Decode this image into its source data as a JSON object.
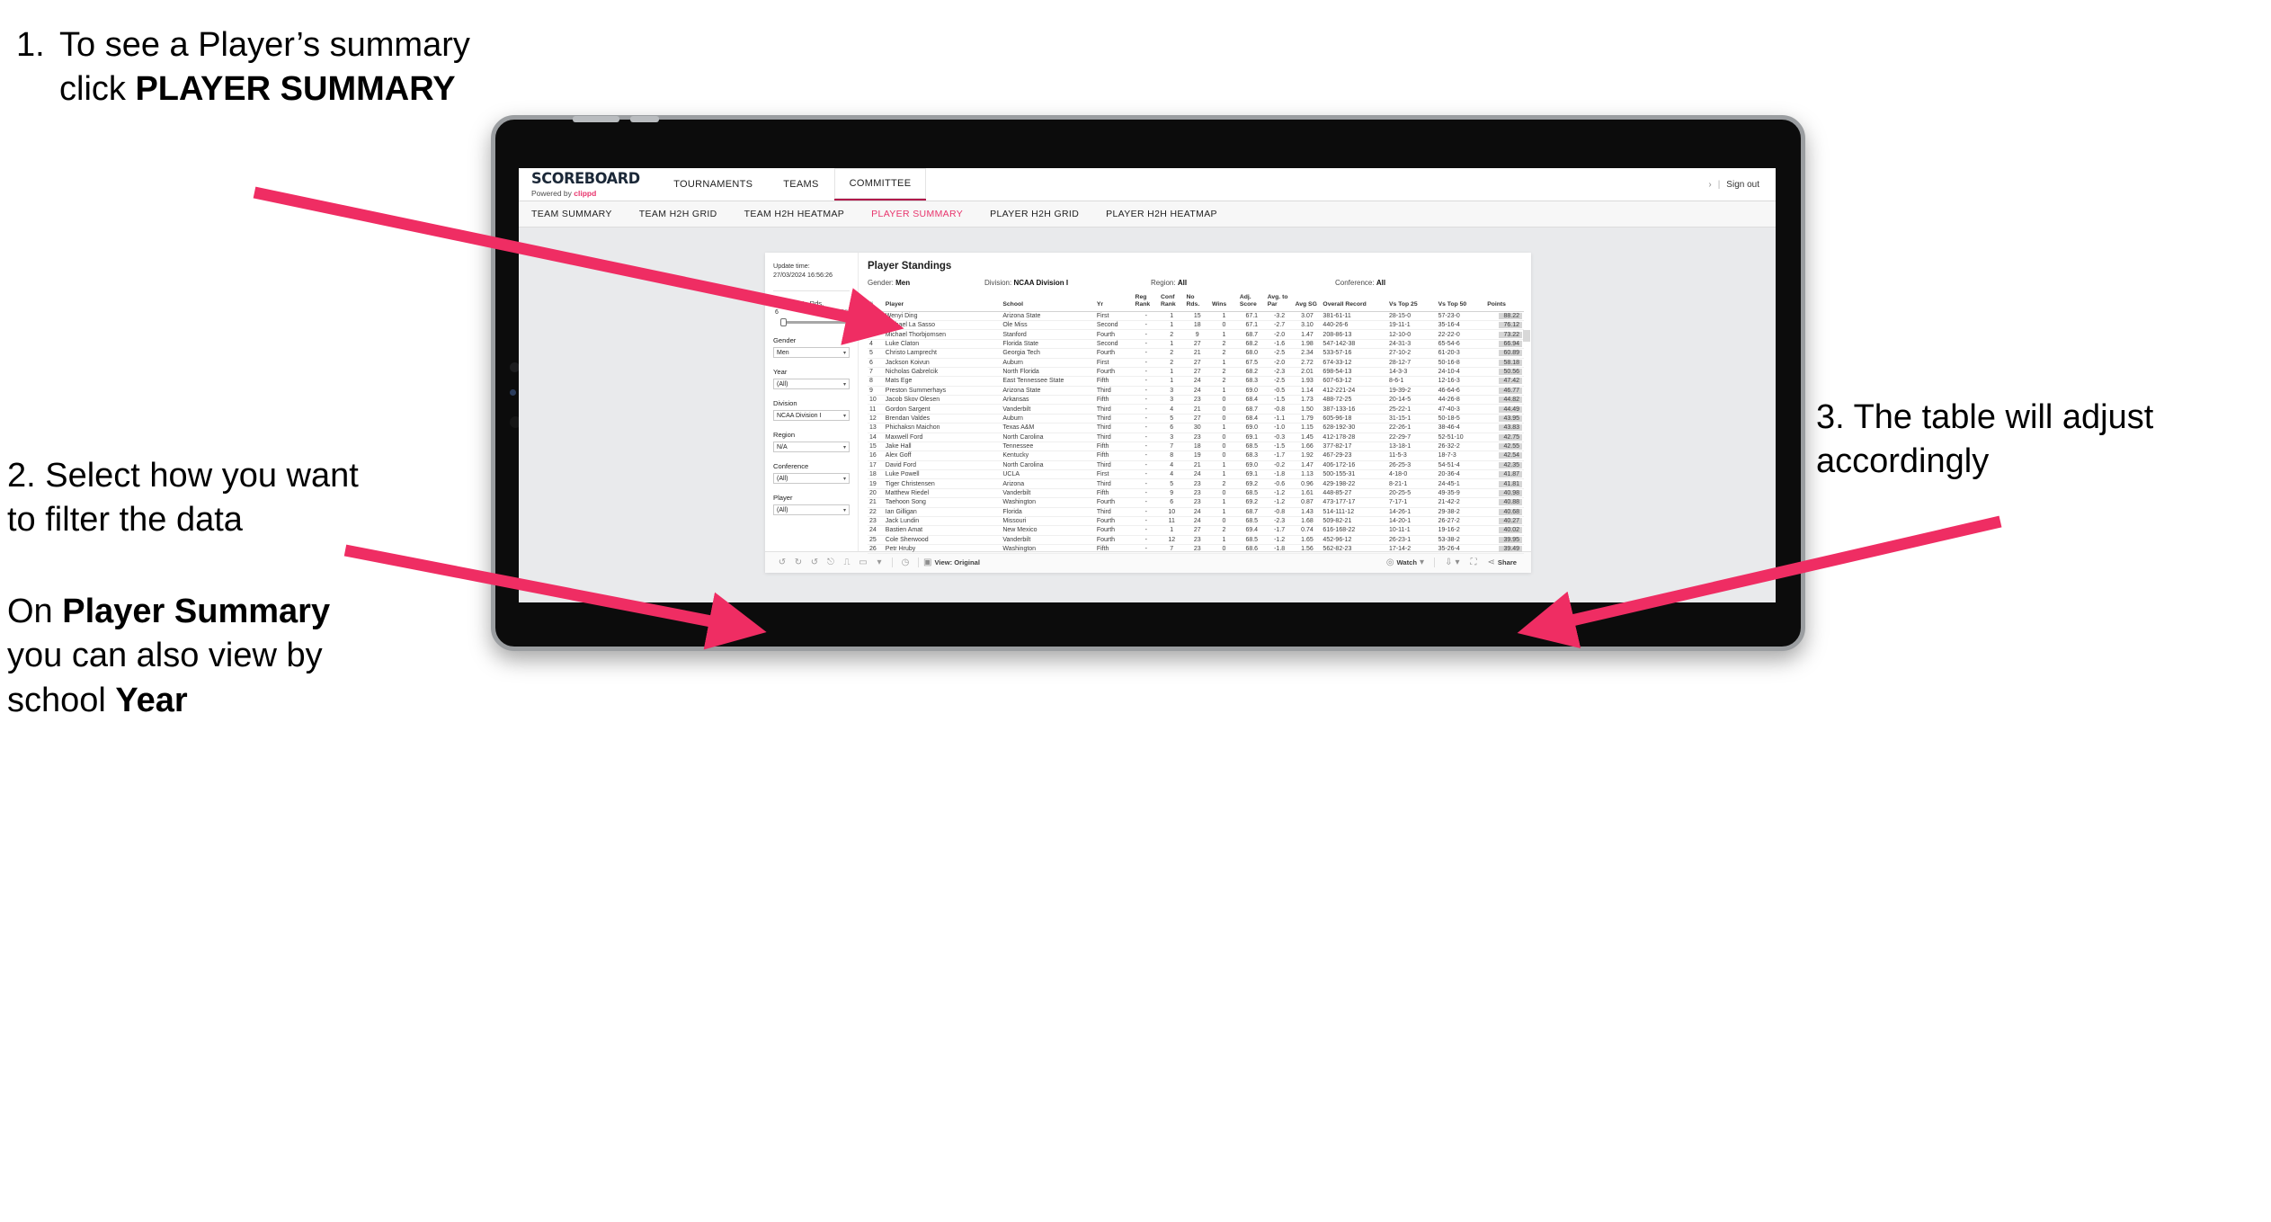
{
  "annotations": {
    "a1": {
      "num": "1.",
      "text_pre": "To see a Player’s summary click ",
      "bold": "PLAYER SUMMARY"
    },
    "a2": {
      "p1": "2. Select how you want to filter the data",
      "p2_pre": "On ",
      "p2_bold1": "Player Summary",
      "p2_mid": " you can also view by school ",
      "p2_bold2": "Year"
    },
    "a3": {
      "text": "3. The table will adjust accordingly"
    },
    "accent_color": "#ef2d63"
  },
  "app": {
    "brand": {
      "title": "SCOREBOARD",
      "sub_pre": "Powered by ",
      "sub_brand": "clippd"
    },
    "top_nav": [
      {
        "label": "TOURNAMENTS",
        "active": false
      },
      {
        "label": "TEAMS",
        "active": false
      },
      {
        "label": "COMMITTEE",
        "active": true
      }
    ],
    "header_right": {
      "chevron": "›",
      "separator": "|",
      "sign_out": "Sign out"
    },
    "sub_nav": [
      {
        "label": "TEAM SUMMARY",
        "active": false
      },
      {
        "label": "TEAM H2H GRID",
        "active": false
      },
      {
        "label": "TEAM H2H HEATMAP",
        "active": false
      },
      {
        "label": "PLAYER SUMMARY",
        "active": true
      },
      {
        "label": "PLAYER H2H GRID",
        "active": false
      },
      {
        "label": "PLAYER H2H HEATMAP",
        "active": false
      }
    ],
    "accent_pink": "#e8356d"
  },
  "filters": {
    "update_label": "Update time:",
    "update_value": "27/03/2024 16:56:26",
    "slider": {
      "title": "No Rds.",
      "min": "6",
      "max": "52"
    },
    "groups": [
      {
        "label": "Gender",
        "value": "Men"
      },
      {
        "label": "Year",
        "value": "(All)"
      },
      {
        "label": "Division",
        "value": "NCAA Division I"
      },
      {
        "label": "Region",
        "value": "N/A"
      },
      {
        "label": "Conference",
        "value": "(All)"
      },
      {
        "label": "Player",
        "value": "(All)"
      }
    ]
  },
  "standings": {
    "title": "Player Standings",
    "meta": [
      {
        "label": "Gender:",
        "value": "Men"
      },
      {
        "label": "Division:",
        "value": "NCAA Division I"
      },
      {
        "label": "Region:",
        "value": "All"
      },
      {
        "label": "Conference:",
        "value": "All"
      }
    ],
    "columns": [
      "#",
      "Player",
      "School",
      "Yr",
      "Reg Rank",
      "Conf Rank",
      "No Rds.",
      "Wins",
      "Adj. Score",
      "Avg. to Par",
      "Avg SG",
      "Overall Record",
      "Vs Top 25",
      "Vs Top 50",
      "Points"
    ],
    "rows": [
      [
        "1",
        "Wenyi Ding",
        "Arizona State",
        "First",
        "-",
        "1",
        "15",
        "1",
        "67.1",
        "-3.2",
        "3.07",
        "381-61-11",
        "28-15-0",
        "57-23-0",
        "88.22"
      ],
      [
        "2",
        "Michael La Sasso",
        "Ole Miss",
        "Second",
        "-",
        "1",
        "18",
        "0",
        "67.1",
        "-2.7",
        "3.10",
        "440-26-6",
        "19-11-1",
        "35-16-4",
        "76.12"
      ],
      [
        "3",
        "Michael Thorbjornsen",
        "Stanford",
        "Fourth",
        "-",
        "2",
        "9",
        "1",
        "68.7",
        "-2.0",
        "1.47",
        "208-86-13",
        "12-10-0",
        "22-22-0",
        "73.22"
      ],
      [
        "4",
        "Luke Claton",
        "Florida State",
        "Second",
        "-",
        "1",
        "27",
        "2",
        "68.2",
        "-1.6",
        "1.98",
        "547-142-38",
        "24-31-3",
        "65-54-6",
        "66.94"
      ],
      [
        "5",
        "Christo Lamprecht",
        "Georgia Tech",
        "Fourth",
        "-",
        "2",
        "21",
        "2",
        "68.0",
        "-2.5",
        "2.34",
        "533-57-16",
        "27-10-2",
        "61-20-3",
        "60.89"
      ],
      [
        "6",
        "Jackson Koivun",
        "Auburn",
        "First",
        "-",
        "2",
        "27",
        "1",
        "67.5",
        "-2.0",
        "2.72",
        "674-33-12",
        "28-12-7",
        "50-16-8",
        "58.18"
      ],
      [
        "7",
        "Nicholas Gabrelcik",
        "North Florida",
        "Fourth",
        "-",
        "1",
        "27",
        "2",
        "68.2",
        "-2.3",
        "2.01",
        "698-54-13",
        "14-3-3",
        "24-10-4",
        "50.56"
      ],
      [
        "8",
        "Mats Ege",
        "East Tennessee State",
        "Fifth",
        "-",
        "1",
        "24",
        "2",
        "68.3",
        "-2.5",
        "1.93",
        "607-63-12",
        "8-6-1",
        "12-16-3",
        "47.42"
      ],
      [
        "9",
        "Preston Summerhays",
        "Arizona State",
        "Third",
        "-",
        "3",
        "24",
        "1",
        "69.0",
        "-0.5",
        "1.14",
        "412-221-24",
        "19-39-2",
        "46-64-6",
        "46.77"
      ],
      [
        "10",
        "Jacob Skov Olesen",
        "Arkansas",
        "Fifth",
        "-",
        "3",
        "23",
        "0",
        "68.4",
        "-1.5",
        "1.73",
        "488-72-25",
        "20-14-5",
        "44-26-8",
        "44.82"
      ],
      [
        "11",
        "Gordon Sargent",
        "Vanderbilt",
        "Third",
        "-",
        "4",
        "21",
        "0",
        "68.7",
        "-0.8",
        "1.50",
        "387-133-16",
        "25-22-1",
        "47-40-3",
        "44.49"
      ],
      [
        "12",
        "Brendan Valdes",
        "Auburn",
        "Third",
        "-",
        "5",
        "27",
        "0",
        "68.4",
        "-1.1",
        "1.79",
        "605-96-18",
        "31-15-1",
        "50-18-5",
        "43.95"
      ],
      [
        "13",
        "Phichaksn Maichon",
        "Texas A&M",
        "Third",
        "-",
        "6",
        "30",
        "1",
        "69.0",
        "-1.0",
        "1.15",
        "628-192-30",
        "22-26-1",
        "38-46-4",
        "43.83"
      ],
      [
        "14",
        "Maxwell Ford",
        "North Carolina",
        "Third",
        "-",
        "3",
        "23",
        "0",
        "69.1",
        "-0.3",
        "1.45",
        "412-178-28",
        "22-29-7",
        "52-51-10",
        "42.75"
      ],
      [
        "15",
        "Jake Hall",
        "Tennessee",
        "Fifth",
        "-",
        "7",
        "18",
        "0",
        "68.5",
        "-1.5",
        "1.66",
        "377-82-17",
        "13-18-1",
        "26-32-2",
        "42.55"
      ],
      [
        "16",
        "Alex Goff",
        "Kentucky",
        "Fifth",
        "-",
        "8",
        "19",
        "0",
        "68.3",
        "-1.7",
        "1.92",
        "467-29-23",
        "11-5-3",
        "18-7-3",
        "42.54"
      ],
      [
        "17",
        "David Ford",
        "North Carolina",
        "Third",
        "-",
        "4",
        "21",
        "1",
        "69.0",
        "-0.2",
        "1.47",
        "406-172-16",
        "26-25-3",
        "54-51-4",
        "42.35"
      ],
      [
        "18",
        "Luke Powell",
        "UCLA",
        "First",
        "-",
        "4",
        "24",
        "1",
        "69.1",
        "-1.8",
        "1.13",
        "500-155-31",
        "4-18-0",
        "20-36-4",
        "41.87"
      ],
      [
        "19",
        "Tiger Christensen",
        "Arizona",
        "Third",
        "-",
        "5",
        "23",
        "2",
        "69.2",
        "-0.6",
        "0.96",
        "429-198-22",
        "8-21-1",
        "24-45-1",
        "41.81"
      ],
      [
        "20",
        "Matthew Riedel",
        "Vanderbilt",
        "Fifth",
        "-",
        "9",
        "23",
        "0",
        "68.5",
        "-1.2",
        "1.61",
        "448-85-27",
        "20-25-5",
        "49-35-9",
        "40.98"
      ],
      [
        "21",
        "Taehoon Song",
        "Washington",
        "Fourth",
        "-",
        "6",
        "23",
        "1",
        "69.2",
        "-1.2",
        "0.87",
        "473-177-17",
        "7-17-1",
        "21-42-2",
        "40.88"
      ],
      [
        "22",
        "Ian Gilligan",
        "Florida",
        "Third",
        "-",
        "10",
        "24",
        "1",
        "68.7",
        "-0.8",
        "1.43",
        "514-111-12",
        "14-26-1",
        "29-38-2",
        "40.68"
      ],
      [
        "23",
        "Jack Lundin",
        "Missouri",
        "Fourth",
        "-",
        "11",
        "24",
        "0",
        "68.5",
        "-2.3",
        "1.68",
        "509-82-21",
        "14-20-1",
        "26-27-2",
        "40.27"
      ],
      [
        "24",
        "Bastien Amat",
        "New Mexico",
        "Fourth",
        "-",
        "1",
        "27",
        "2",
        "69.4",
        "-1.7",
        "0.74",
        "616-168-22",
        "10-11-1",
        "19-16-2",
        "40.02"
      ],
      [
        "25",
        "Cole Sherwood",
        "Vanderbilt",
        "Fourth",
        "-",
        "12",
        "23",
        "1",
        "68.5",
        "-1.2",
        "1.65",
        "452-96-12",
        "26-23-1",
        "53-38-2",
        "39.95"
      ],
      [
        "26",
        "Petr Hruby",
        "Washington",
        "Fifth",
        "-",
        "7",
        "23",
        "0",
        "68.6",
        "-1.8",
        "1.56",
        "562-82-23",
        "17-14-2",
        "35-26-4",
        "39.49"
      ]
    ]
  },
  "workbook_toolbar": {
    "left_icons": [
      "undo-icon",
      "redo-icon",
      "revert-icon",
      "refresh-icon",
      "pause-icon",
      "rectangle-select-icon",
      "caret-icon"
    ],
    "clock_icon": "clock-icon",
    "view_label": "View: Original",
    "watch_label": "Watch",
    "share_label": "Share",
    "right_icons": [
      "download-icon",
      "fullscreen-icon",
      "share-icon"
    ]
  }
}
